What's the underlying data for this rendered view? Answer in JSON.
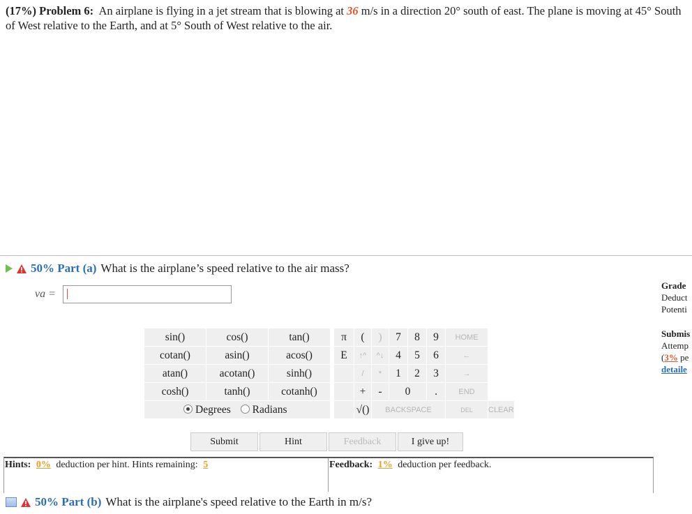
{
  "problem": {
    "prefix": "(17%) Problem 6:",
    "text1": "An airplane is flying in a jet stream that is blowing at",
    "speed": "36",
    "text2": "m/s in a direction 20° south of east. The plane is moving at 45° South of West relative to the Earth, and at 5° South of West relative to the air."
  },
  "partA": {
    "percent": "50% Part (a)",
    "question": "What is the airplane’s speed relative to the air mass?",
    "var_label": "va =",
    "input_value": ""
  },
  "calc": {
    "funcs": [
      [
        "sin()",
        "cos()",
        "tan()"
      ],
      [
        "cotan()",
        "asin()",
        "acos()"
      ],
      [
        "atan()",
        "acotan()",
        "sinh()"
      ],
      [
        "cosh()",
        "tanh()",
        "cotanh()"
      ]
    ],
    "pi": "π",
    "e": "E",
    "open_paren": "(",
    "close_paren": ")",
    "up_arrow": "↑^",
    "down_arrow": "^↓",
    "divide": "/",
    "multiply": "*",
    "plus": "+",
    "minus": "-",
    "sqrt": "√()",
    "digits_row1": [
      "7",
      "8",
      "9"
    ],
    "digits_row2": [
      "4",
      "5",
      "6"
    ],
    "digits_row3": [
      "1",
      "2",
      "3"
    ],
    "zero": "0",
    "dot": ".",
    "home": "HOME",
    "left_arrow": "←",
    "right_arrow": "→",
    "end": "END",
    "backspace": "BACKSPACE",
    "del": "DEL",
    "clear": "CLEAR",
    "degrees": "Degrees",
    "radians": "Radians"
  },
  "buttons": {
    "submit": "Submit",
    "hint": "Hint",
    "feedback": "Feedback",
    "give_up": "I give up!"
  },
  "side": {
    "grade": "Grade",
    "deduct": "Deduct",
    "potential": "Potenti",
    "submissions": "Submis",
    "attempts": "Attemp",
    "pct": "3%",
    "pct_rest": " pe",
    "detailed": "detaile"
  },
  "hints": {
    "label": "Hints:",
    "pct": "0%",
    "text": "deduction per hint. Hints remaining:",
    "remaining": "5"
  },
  "feedback": {
    "label": "Feedback:",
    "pct": "1%",
    "text": "deduction per feedback."
  },
  "partB": {
    "percent": "50% Part (b)",
    "question": "What is the airplane's speed relative to the Earth in m/s?"
  }
}
